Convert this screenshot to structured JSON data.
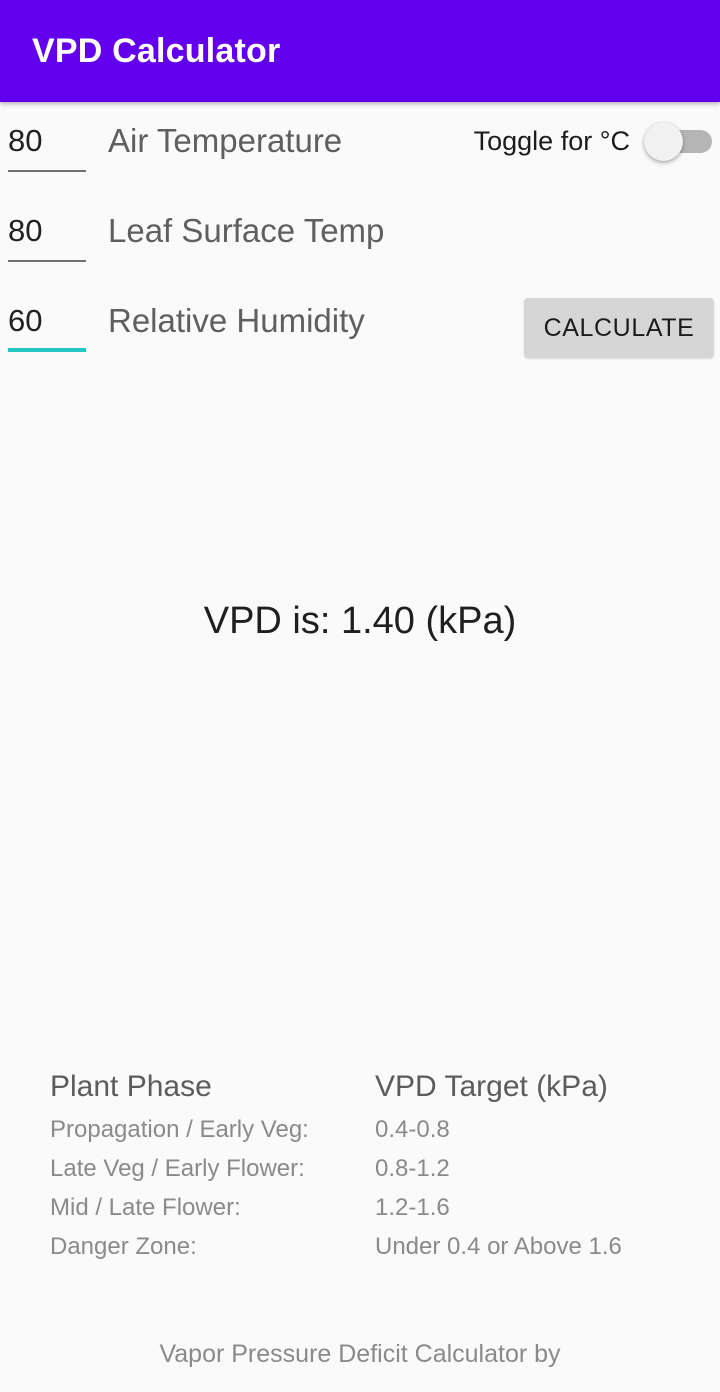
{
  "app": {
    "title": "VPD Calculator",
    "bar_color": "#6200ee",
    "background_color": "#fafafa"
  },
  "inputs": {
    "air_temperature": {
      "value": "80",
      "label": "Air Temperature",
      "focused": false
    },
    "leaf_surface_temp": {
      "value": "80",
      "label": "Leaf Surface Temp",
      "focused": false
    },
    "relative_humidity": {
      "value": "60",
      "label": "Relative Humidity",
      "focused": true
    }
  },
  "toggle": {
    "label": "Toggle for °C",
    "state": "off",
    "accent_color": "#24c7c4"
  },
  "actions": {
    "calculate_label": "CALCULATE"
  },
  "result": {
    "text": "VPD is: 1.40 (kPa)",
    "value": "1.40",
    "unit": "kPa"
  },
  "reference_table": {
    "headers": [
      "Plant Phase",
      "VPD Target (kPa)"
    ],
    "rows": [
      {
        "phase": "Propagation / Early Veg:",
        "target": "0.4-0.8"
      },
      {
        "phase": "Late Veg / Early Flower:",
        "target": "0.8-1.2"
      },
      {
        "phase": "Mid / Late Flower:",
        "target": "1.2-1.6"
      },
      {
        "phase": "Danger Zone:",
        "target": "Under 0.4 or Above 1.6"
      }
    ]
  },
  "footer": {
    "text": "Vapor Pressure Deficit Calculator by"
  }
}
